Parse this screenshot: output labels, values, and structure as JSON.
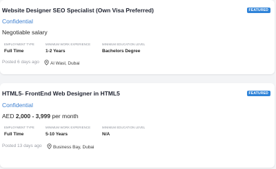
{
  "jobs": [
    {
      "title": "Website Designer SEO Specialist (Own Visa Preferred)",
      "badge": "FEATURED",
      "company": "Confidential",
      "salary_text": "Negotiable salary",
      "details": [
        {
          "label": "EMPLOYMENT TYPE",
          "value": "Full Time"
        },
        {
          "label": "MINIMUM WORK EXPERIENCE",
          "value": "1-2 Years"
        },
        {
          "label": "MINIMUM EDUCATION LEVEL",
          "value": "Bachelors Degree"
        }
      ],
      "posted": "Posted 6 days ago",
      "location": "Al Wasl, Dubai",
      "location_icon": "map-pin-icon"
    },
    {
      "title": "HTML5- FrontEnd Web Designer in HTML5",
      "badge": "FEATURED",
      "company": "Confidential",
      "salary_prefix": "AED",
      "salary_range": "2,000 - 3,999",
      "salary_suffix": "per month",
      "details": [
        {
          "label": "EMPLOYMENT TYPE",
          "value": "Full Time"
        },
        {
          "label": "MINIMUM WORK EXPERIENCE",
          "value": "5-10 Years"
        },
        {
          "label": "MINIMUM EDUCATION LEVEL",
          "value": "N/A"
        }
      ],
      "posted": "Posted 13 days ago",
      "location": "Business Bay, Dubai",
      "location_icon": "map-pin-icon"
    }
  ],
  "colors": {
    "badge_bg": "#2f83d8",
    "company": "#3c7fd0",
    "background": "#f3f4f6"
  }
}
